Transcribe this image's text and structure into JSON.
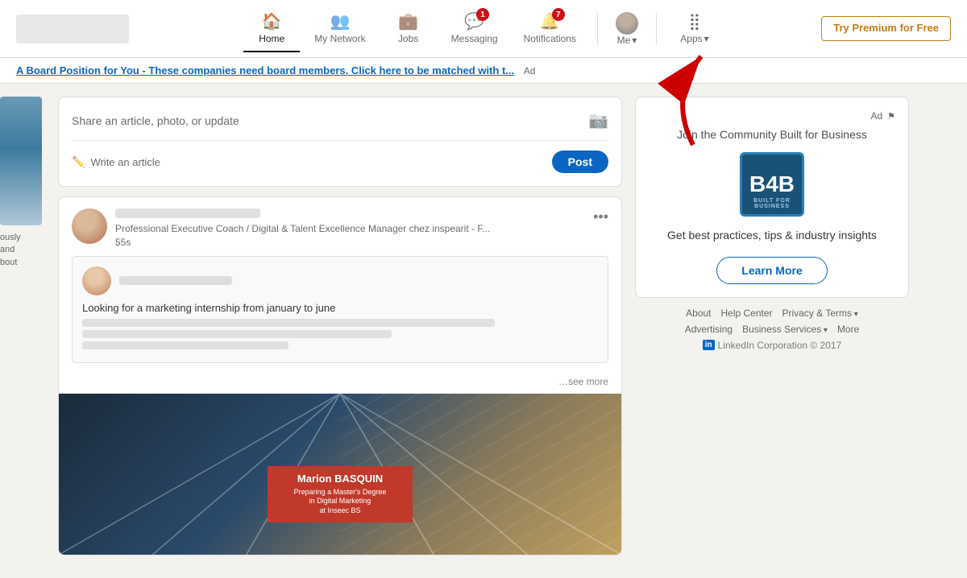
{
  "navbar": {
    "logo_alt": "LinkedIn",
    "nav_items": [
      {
        "id": "home",
        "label": "Home",
        "icon": "🏠",
        "active": true,
        "badge": null
      },
      {
        "id": "network",
        "label": "My Network",
        "icon": "👥",
        "active": false,
        "badge": null
      },
      {
        "id": "jobs",
        "label": "Jobs",
        "icon": "💼",
        "active": false,
        "badge": null
      },
      {
        "id": "messaging",
        "label": "Messaging",
        "icon": "💬",
        "active": false,
        "badge": "1"
      },
      {
        "id": "notifications",
        "label": "Notifications",
        "icon": "🔔",
        "active": false,
        "badge": "7"
      }
    ],
    "me_label": "Me",
    "apps_label": "Apps",
    "premium_label": "Try Premium for Free"
  },
  "ad_banner": {
    "text": "A Board Position for You - These companies need board members. Click here to be matched with t...",
    "ad_label": "Ad"
  },
  "share_box": {
    "placeholder": "Share an article, photo, or update",
    "write_article": "Write an article",
    "post_button": "Post"
  },
  "post": {
    "meta_line1": "Professional Executive Coach / Digital & Talent Excellence Manager chez inspearit - F...",
    "meta_line2": "55s",
    "shared_text": "Looking for a marketing internship from january to june",
    "see_more": "…see more"
  },
  "ad_card": {
    "ad_label": "Ad",
    "title": "Join the Community Built for Business",
    "logo_text": "B4B",
    "logo_sub": "BUILT FOR BUSINESS",
    "description": "Get best practices, tips & industry insights",
    "learn_more": "Learn More"
  },
  "footer": {
    "links": [
      {
        "label": "About",
        "has_arrow": false
      },
      {
        "label": "Help Center",
        "has_arrow": false
      },
      {
        "label": "Privacy & Terms",
        "has_arrow": true
      },
      {
        "label": "Advertising",
        "has_arrow": false
      },
      {
        "label": "Business Services",
        "has_arrow": true
      },
      {
        "label": "More",
        "has_arrow": false
      }
    ],
    "copyright": "LinkedIn Corporation © 2017"
  },
  "sidebar_text": {
    "line1": "ously",
    "line2": "and",
    "line3": "bout"
  }
}
